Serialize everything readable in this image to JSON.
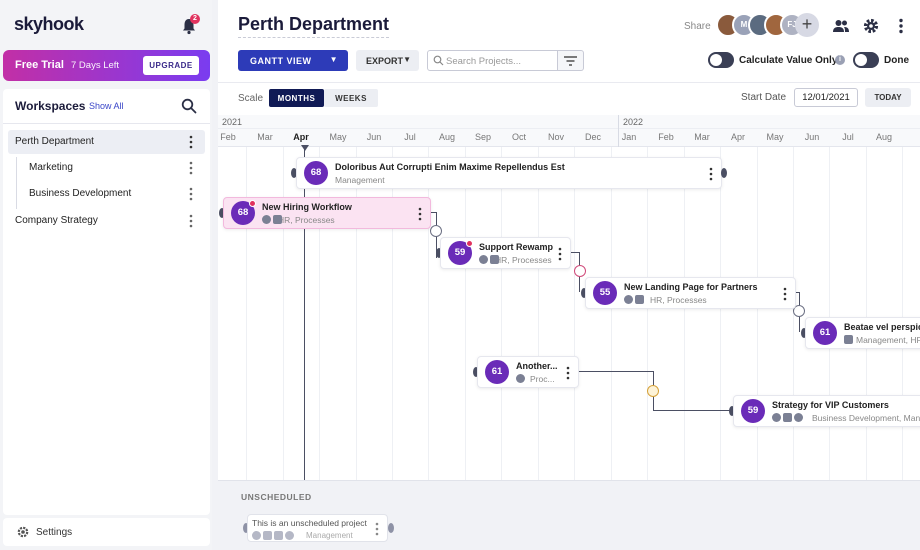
{
  "app": {
    "logo": "skyhook",
    "notifications": "2"
  },
  "trial": {
    "title": "Free Trial",
    "days": "7 Days Left",
    "upgrade": "UPGRADE"
  },
  "workspaces": {
    "title": "Workspaces",
    "show_all": "Show All",
    "items": [
      {
        "label": "Perth Department"
      },
      {
        "label": "Marketing"
      },
      {
        "label": "Business Development"
      },
      {
        "label": "Company Strategy"
      }
    ]
  },
  "settings": {
    "label": "Settings"
  },
  "header": {
    "title": "Perth Department",
    "share": "Share",
    "avatars": [
      {
        "initials": "",
        "color": "#8a5a3c"
      },
      {
        "initials": "M",
        "color": "#9aa2b8"
      },
      {
        "initials": "",
        "color": "#5b6b80"
      },
      {
        "initials": "",
        "color": "#a0663e"
      },
      {
        "initials": "FJ",
        "color": "#aeb2c2"
      }
    ],
    "add": "+"
  },
  "toolbar": {
    "gantt": "GANTT VIEW",
    "export": "EXPORT",
    "search_placeholder": "Search Projects...",
    "calc_toggle": "Calculate Value Only",
    "info": "i",
    "done_toggle": "Done"
  },
  "scale": {
    "label": "Scale",
    "months": "MONTHS",
    "weeks": "WEEKS",
    "start_label": "Start Date",
    "start_date": "12/01/2021",
    "today": "TODAY"
  },
  "timeline": {
    "years": [
      "2021",
      "2022"
    ],
    "months": [
      "Feb",
      "Mar",
      "Apr",
      "May",
      "Jun",
      "Jul",
      "Aug",
      "Sep",
      "Oct",
      "Nov",
      "Dec",
      "Jan",
      "Feb",
      "Mar",
      "Apr",
      "May",
      "Jun",
      "Jul",
      "Aug"
    ]
  },
  "tasks": [
    {
      "num": "68",
      "title": "Doloribus Aut Corrupti Enim Maxime Repellendus Est",
      "sub": "Management"
    },
    {
      "num": "68",
      "title": "New Hiring Workflow",
      "sub": "HR, Processes"
    },
    {
      "num": "59",
      "title": "Support Rewamp",
      "sub": "HR, Processes"
    },
    {
      "num": "55",
      "title": "New Landing Page for Partners",
      "sub": "HR, Processes"
    },
    {
      "num": "61",
      "title": "Beatae vel perspiciatis",
      "sub": "Management, HR"
    },
    {
      "num": "61",
      "title": "Another...",
      "sub": "Proc..."
    },
    {
      "num": "59",
      "title": "Strategy for VIP Customers",
      "sub": "Business Development, Management"
    }
  ],
  "unscheduled": {
    "label": "UNSCHEDULED",
    "card_title": "This is an unscheduled project",
    "card_sub": "Management"
  },
  "colors": {
    "accent": "#2d3bb8",
    "task_badge": "#6a2bb8",
    "highlight": "#fbe3f2",
    "trial_start": "#c22fa6",
    "trial_end": "#7a3cf0"
  }
}
